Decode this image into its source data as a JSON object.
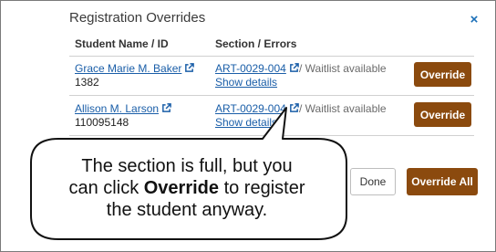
{
  "dialog": {
    "title": "Registration Overrides",
    "close_glyph": "×"
  },
  "columns": {
    "student": "Student Name / ID",
    "section": "Section / Errors"
  },
  "rows": [
    {
      "name": "Grace Marie M. Baker",
      "id": "1382",
      "section": "ART-0029-004",
      "status": " / Waitlist available",
      "details": "Show details",
      "button": "Override"
    },
    {
      "name": "Allison M. Larson",
      "id": "110095148",
      "section": "ART-0029-004",
      "status": " / Waitlist available",
      "details": "Show details",
      "button": "Override"
    }
  ],
  "footer": {
    "done": "Done",
    "override_all": "Override All"
  },
  "callout": {
    "line1": "The section is full, but you",
    "line2_pre": "can click ",
    "line2_bold": "Override",
    "line2_post": " to register",
    "line3": "the student anyway."
  },
  "colors": {
    "accent_brown": "#8b4a0e",
    "link_blue": "#1a5ea8",
    "close_blue": "#1a6fb8"
  },
  "icons": {
    "external_link": "external-link-icon",
    "close": "close-icon"
  }
}
